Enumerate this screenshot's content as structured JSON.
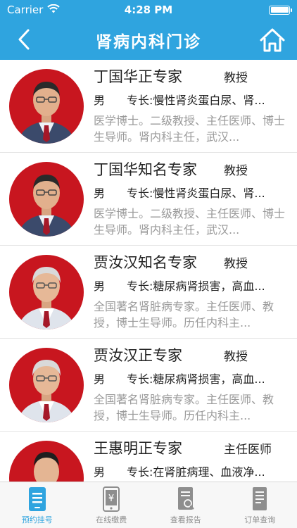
{
  "status_bar": {
    "carrier": "Carrier",
    "time": "4:28 PM"
  },
  "nav": {
    "title": "肾病内科门诊",
    "back_icon": "chevron-left-icon",
    "home_icon": "home-icon"
  },
  "doctors": [
    {
      "name": "丁国华正专家",
      "rank": "教授",
      "gender": "男",
      "specialty": "专长:慢性肾炎蛋白尿、肾...",
      "bio": "医学博士。二级教授、主任医师、博士生导师。肾内科主任，武汉..."
    },
    {
      "name": "丁国华知名专家",
      "rank": "教授",
      "gender": "男",
      "specialty": "专长:慢性肾炎蛋白尿、肾...",
      "bio": "医学博士。二级教授、主任医师、博士生导师。肾内科主任，武汉..."
    },
    {
      "name": "贾汝汉知名专家",
      "rank": "教授",
      "gender": "男",
      "specialty": "专长:糖尿病肾损害，高血...",
      "bio": "全国著名肾脏病专家。主任医师、教授，博士生导师。历任内科主..."
    },
    {
      "name": "贾汝汉正专家",
      "rank": "教授",
      "gender": "男",
      "specialty": "专长:糖尿病肾损害，高血...",
      "bio": "全国著名肾脏病专家。主任医师、教授，博士生导师。历任内科主..."
    },
    {
      "name": "王惠明正专家",
      "rank": "主任医师",
      "gender": "男",
      "specialty": "专长:在肾脏病理、血液净...",
      "bio": ""
    }
  ],
  "tabs": [
    {
      "label": "预约挂号",
      "icon": "phone-list-icon",
      "active": true
    },
    {
      "label": "在线缴费",
      "icon": "mobile-yen-icon",
      "active": false
    },
    {
      "label": "查看报告",
      "icon": "report-search-icon",
      "active": false
    },
    {
      "label": "订单查询",
      "icon": "order-doc-icon",
      "active": false
    }
  ],
  "colors": {
    "brand": "#2fa4df",
    "avatar_bg": "#c8161f",
    "secondary_text": "#9a9a9a"
  }
}
